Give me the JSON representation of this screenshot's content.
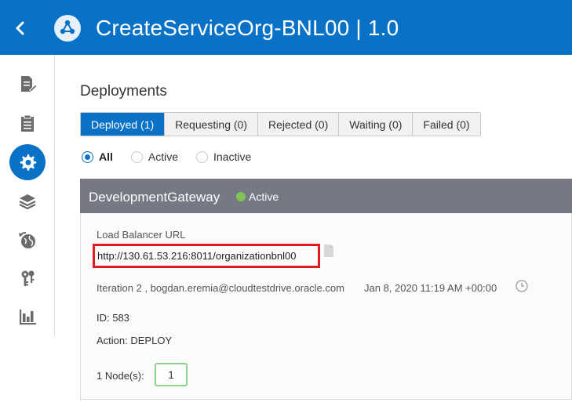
{
  "header": {
    "title": "CreateServiceOrg-BNL00 | 1.0",
    "back_icon": "chevron-left-icon",
    "app_icon": "api-network-icon",
    "background": "#0a72c6"
  },
  "sidebar": {
    "items": [
      {
        "name": "edit-document-icon",
        "active": false
      },
      {
        "name": "clipboard-icon",
        "active": false
      },
      {
        "name": "gear-icon",
        "active": true
      },
      {
        "name": "layers-icon",
        "active": false
      },
      {
        "name": "globe-refresh-icon",
        "active": false
      },
      {
        "name": "keys-icon",
        "active": false
      },
      {
        "name": "bar-chart-icon",
        "active": false
      }
    ]
  },
  "main": {
    "heading": "Deployments",
    "tabs": [
      {
        "label": "Deployed (1)",
        "selected": true
      },
      {
        "label": "Requesting (0)",
        "selected": false
      },
      {
        "label": "Rejected (0)",
        "selected": false
      },
      {
        "label": "Waiting (0)",
        "selected": false
      },
      {
        "label": "Failed (0)",
        "selected": false
      }
    ],
    "filters": [
      {
        "label": "All",
        "checked": true
      },
      {
        "label": "Active",
        "checked": false
      },
      {
        "label": "Inactive",
        "checked": false
      }
    ]
  },
  "deployment": {
    "environment": "DevelopmentGateway",
    "status": "Active",
    "status_color": "#7ec557",
    "lb_label": "Load Balancer URL",
    "lb_url": "http://130.61.53.216:8011/organizationbnl00",
    "iteration": "Iteration 2 , bogdan.eremia@cloudtestdrive.oracle.com",
    "timestamp": "Jan 8, 2020 11:19 AM +00:00",
    "id_text": "ID: 583",
    "action_text": "Action: DEPLOY",
    "nodes_label": "1 Node(s):",
    "nodes_value": "1",
    "highlight_color": "#e11b22"
  }
}
